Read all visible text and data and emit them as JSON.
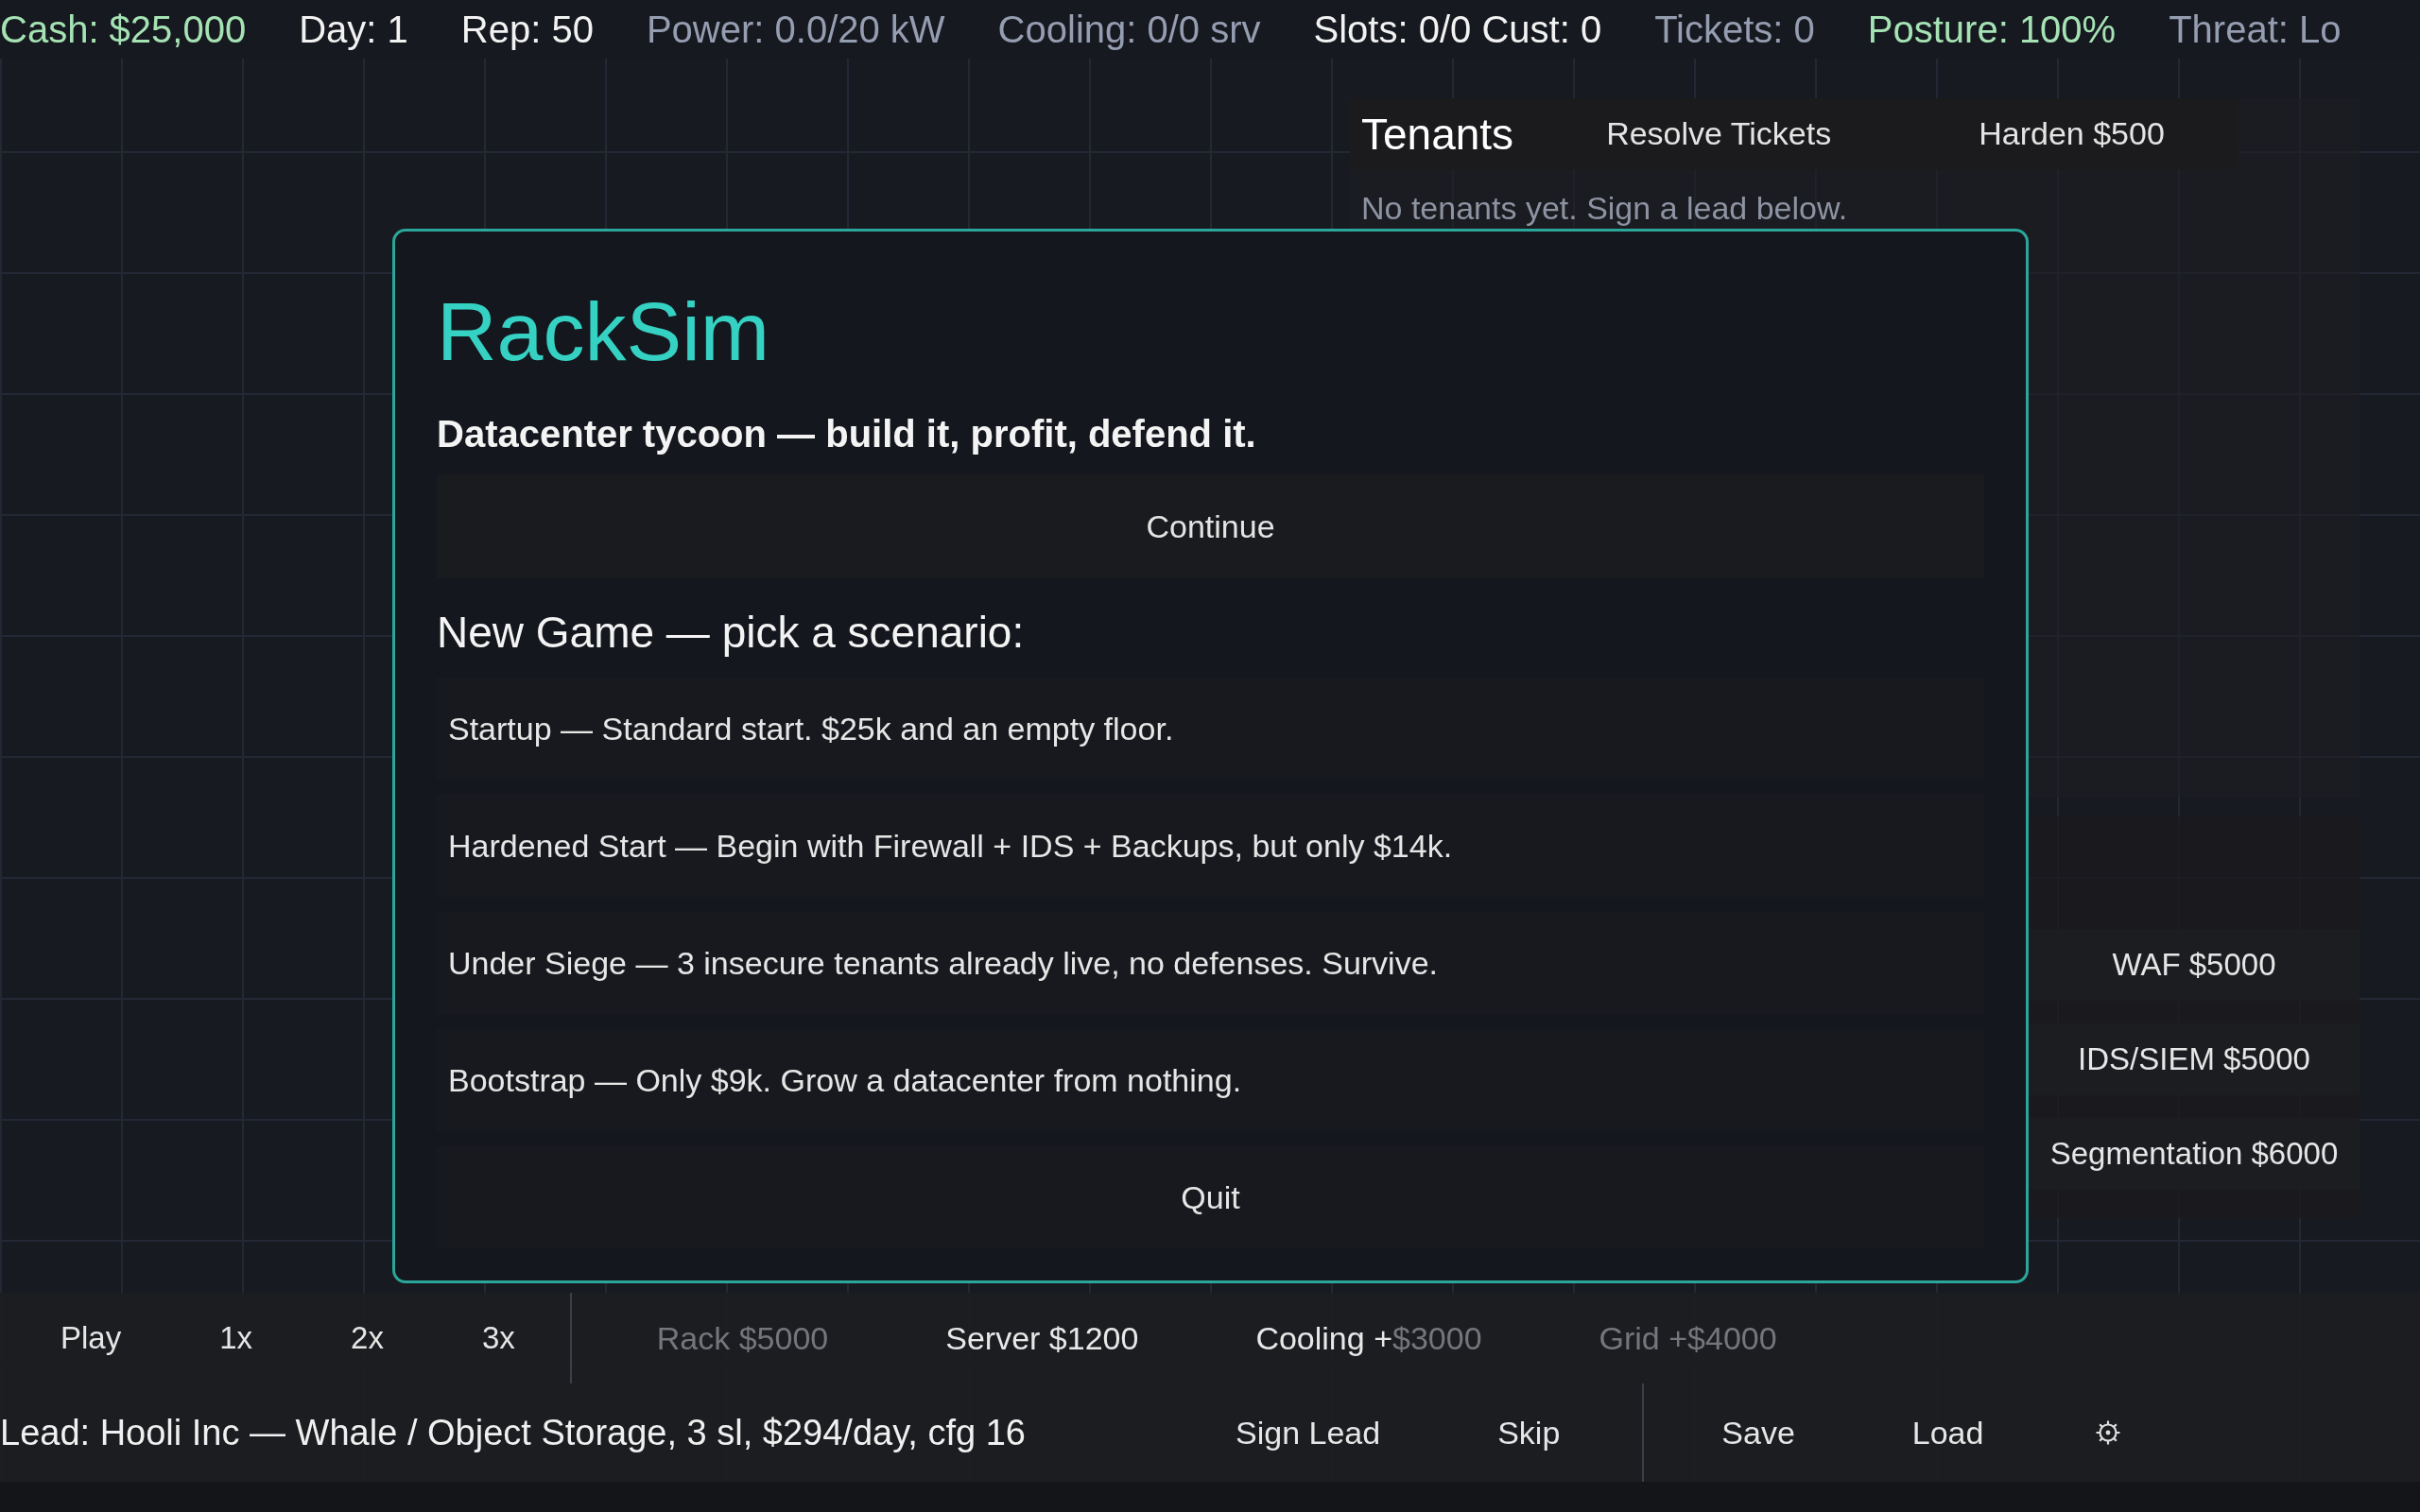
{
  "status_bar": {
    "stats": [
      {
        "text": "Cash: $25,000",
        "color": "#a6e3b4"
      },
      {
        "text": "Day: 1",
        "color": "#f2f2f2"
      },
      {
        "text": "Rep: 50",
        "color": "#f2f2f2"
      },
      {
        "text": "Power: 0.0/20 kW",
        "color": "#959db0"
      },
      {
        "text": "Cooling: 0/0 srv",
        "color": "#959db0"
      },
      {
        "text": "Slots: 0/0 Cust: 0",
        "color": "#f2f2f2"
      },
      {
        "text": "Tickets: 0",
        "color": "#959db0"
      },
      {
        "text": "Posture: 100%",
        "color": "#a6e3b4"
      },
      {
        "text": "Threat: Lo",
        "color": "#959db0"
      }
    ]
  },
  "tenants_panel": {
    "title": "Tenants",
    "buttons": [
      "Resolve Tickets",
      "Harden $500"
    ],
    "empty_message": "No tenants yet. Sign a lead below."
  },
  "defenses_panel": {
    "buttons": [
      "WAF $5000",
      "IDS/SIEM $5000",
      "Segmentation $6000"
    ]
  },
  "toolbar": {
    "playback": [
      "Play",
      "1x",
      "2x",
      "3x"
    ],
    "build": [
      {
        "segments": [
          {
            "text": "Rack $5000",
            "dimmed": true
          }
        ]
      },
      {
        "segments": [
          {
            "text": "Server $1200",
            "dimmed": false
          }
        ]
      },
      {
        "segments": [
          {
            "text": "Cooling +",
            "dimmed": false
          },
          {
            "text": "$3000",
            "dimmed": true
          }
        ]
      },
      {
        "segments": [
          {
            "text": "Grid +$4000",
            "dimmed": true
          }
        ]
      }
    ]
  },
  "lead_bar": {
    "lead": "Lead: Hooli Inc — Whale / Object Storage, 3 sl, $294/day, cfg 16",
    "lead_actions": [
      "Sign Lead",
      "Skip"
    ],
    "file_actions": [
      "Save",
      "Load"
    ]
  },
  "start_dialog": {
    "title": "RackSim",
    "tagline": "Datacenter tycoon — build it, profit, defend it.",
    "continue_button": "Continue",
    "new_game_heading": "New Game — pick a scenario:",
    "scenarios": [
      "Startup — Standard start. $25k and an empty floor.",
      "Hardened Start — Begin with Firewall + IDS + Backups, but only $14k.",
      "Under Siege — 3 insecure tenants already live, no defenses. Survive.",
      "Bootstrap — Only $9k. Grow a datacenter from nothing."
    ],
    "quit_button": "Quit"
  }
}
